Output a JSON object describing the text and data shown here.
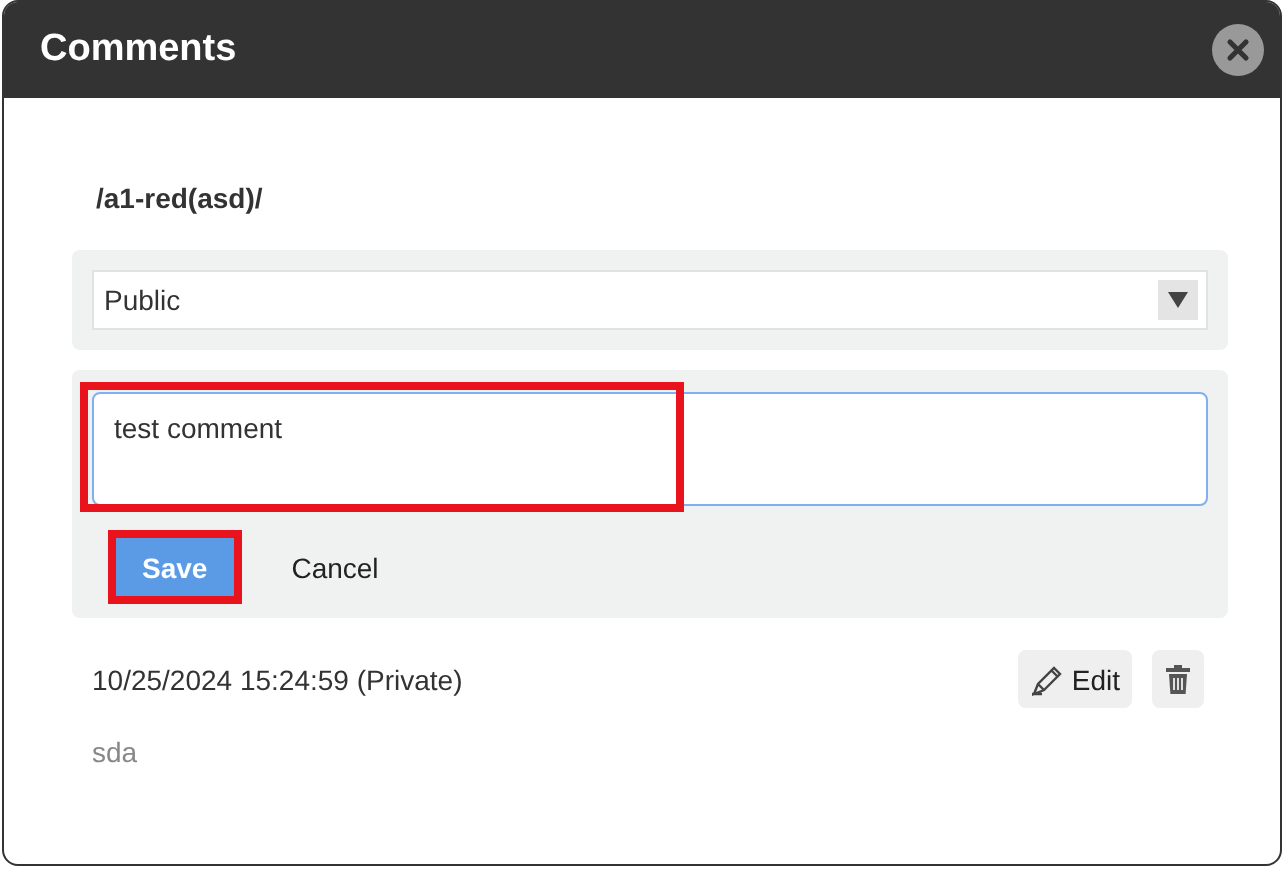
{
  "dialog": {
    "title": "Comments"
  },
  "path": "/a1-red(asd)/",
  "visibility": {
    "value": "Public"
  },
  "editor": {
    "value": "test comment",
    "highlighted": true,
    "buttons": [
      {
        "label": "Save",
        "kind": "primary",
        "highlighted": true
      },
      {
        "label": "Cancel",
        "kind": "plain",
        "highlighted": false
      }
    ]
  },
  "comments": [
    {
      "meta": "10/25/2024 15:24:59 (Private)",
      "text": "sda",
      "edit_label": "Edit"
    }
  ]
}
